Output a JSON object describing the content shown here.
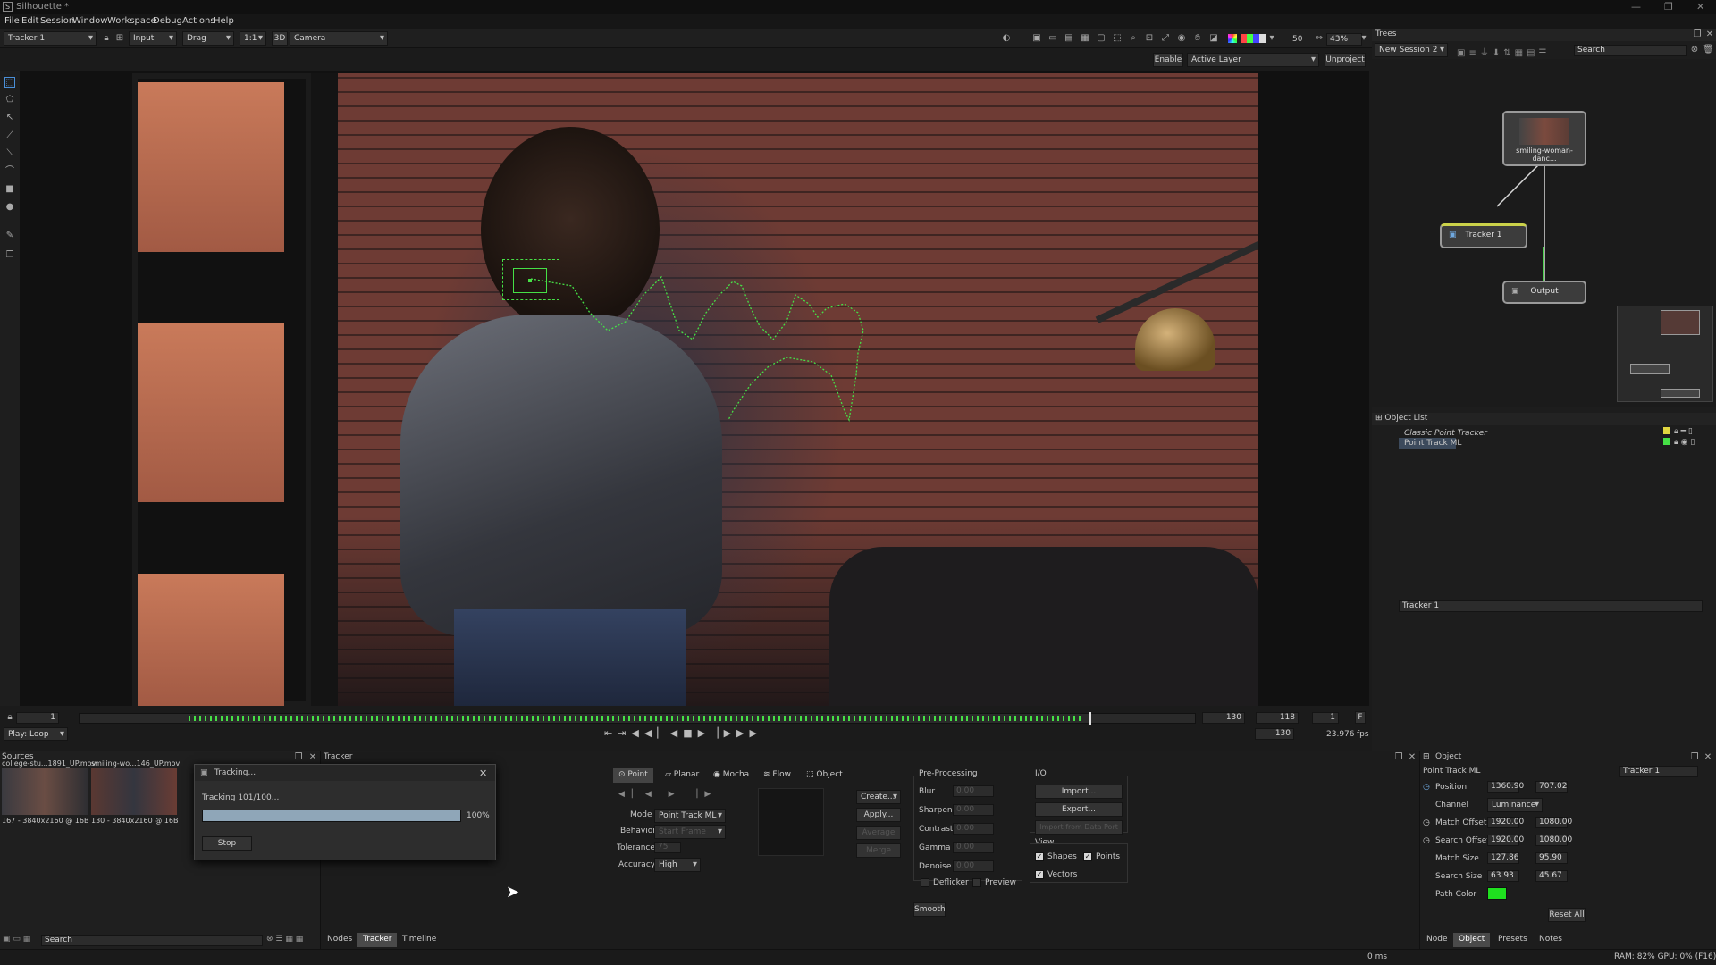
{
  "window": {
    "title": "Silhouette *",
    "logo": "S"
  },
  "menu": [
    "File",
    "Edit",
    "Session",
    "Window",
    "Workspace",
    "Debug",
    "Actions",
    "Help"
  ],
  "toolbar": {
    "node": "Tracker 1",
    "view": "Input",
    "mode": "Drag",
    "ratio": "1:1",
    "threeD": "3D",
    "camera": "Camera",
    "frame_val": "50",
    "zoom": "43%",
    "enable": "Enable",
    "layer": "Active Layer",
    "unproject": "Unproject"
  },
  "trees": {
    "title": "Trees",
    "session": "New Session 2",
    "search_placeholder": "Search",
    "nodes": {
      "source": "smiling-woman-danc...",
      "tracker": "Tracker 1",
      "output": "Output"
    }
  },
  "object_list": {
    "title": "Object List",
    "items": [
      "Classic Point Tracker",
      "Point Track ML"
    ]
  },
  "timeline": {
    "start": "1",
    "end_a": "130",
    "current": "118",
    "step": "1",
    "f_label": "F",
    "play_mode": "Play: Loop",
    "end_b": "130",
    "fps": "23.976",
    "fps_unit": "fps"
  },
  "sources": {
    "title": "Sources",
    "items": [
      {
        "name": "college-stu...1891_UP.mov",
        "info": "167 - 3840x2160 @ 16B"
      },
      {
        "name": "smiling-wo...146_UP.mov",
        "info": "130 - 3840x2160 @ 16B"
      }
    ],
    "search_placeholder": "Search"
  },
  "tracking_dialog": {
    "title": "Tracking...",
    "status": "Tracking 101/100...",
    "progress": 1.0,
    "percent": "100%",
    "stop": "Stop"
  },
  "tracker_panel": {
    "title": "Tracker",
    "tabs": [
      "Point",
      "Planar",
      "Mocha",
      "Flow",
      "Object"
    ],
    "mode_label": "Mode",
    "mode_value": "Point Track ML",
    "behavior_label": "Behavior",
    "behavior_value": "Start Frame",
    "tolerance_label": "Tolerance",
    "tolerance_value": "75",
    "accuracy_label": "Accuracy",
    "accuracy_value": "High",
    "create": "Create...",
    "apply": "Apply...",
    "average": "Average",
    "merge": "Merge",
    "preprocessing": {
      "title": "Pre-Processing",
      "rows": [
        {
          "label": "Blur",
          "value": "0.00"
        },
        {
          "label": "Sharpen",
          "value": "0.00"
        },
        {
          "label": "Contrast",
          "value": "0.00"
        },
        {
          "label": "Gamma",
          "value": "0.00"
        },
        {
          "label": "Denoise",
          "value": "0.00"
        }
      ],
      "deflicker": "Deflicker",
      "preview": "Preview"
    },
    "smooth": "Smooth",
    "io": {
      "title": "I/O",
      "import": "Import...",
      "export": "Export...",
      "import_port": "Import from Data Port"
    },
    "view": {
      "title": "View",
      "shapes": "Shapes",
      "points": "Points",
      "vectors": "Vectors"
    }
  },
  "bottom_tabs": [
    "Nodes",
    "Tracker",
    "Timeline"
  ],
  "object_panel": {
    "node_field": "Tracker 1",
    "title": "Object",
    "name": "Point Track ML",
    "tracker": "Tracker 1",
    "position": {
      "label": "Position",
      "x": "1360.90",
      "y": "707.02"
    },
    "channel": {
      "label": "Channel",
      "value": "Luminance"
    },
    "match_offset": {
      "label": "Match Offset",
      "x": "1920.00",
      "y": "1080.00"
    },
    "search_offset": {
      "label": "Search Offset",
      "x": "1920.00",
      "y": "1080.00"
    },
    "match_size": {
      "label": "Match Size",
      "x": "127.86",
      "y": "95.90"
    },
    "search_size": {
      "label": "Search Size",
      "x": "63.93",
      "y": "45.67"
    },
    "path_color": {
      "label": "Path Color",
      "color": "#1fe01f"
    },
    "reset": "Reset All",
    "tabs": [
      "Node",
      "Object",
      "Presets",
      "Notes"
    ]
  },
  "status": {
    "ms": "0 ms",
    "ram": "RAM: 82% GPU: 0% (F16)"
  },
  "colors": {
    "accent_green": "#46e046",
    "progress_blue": "#8fa6b8"
  }
}
